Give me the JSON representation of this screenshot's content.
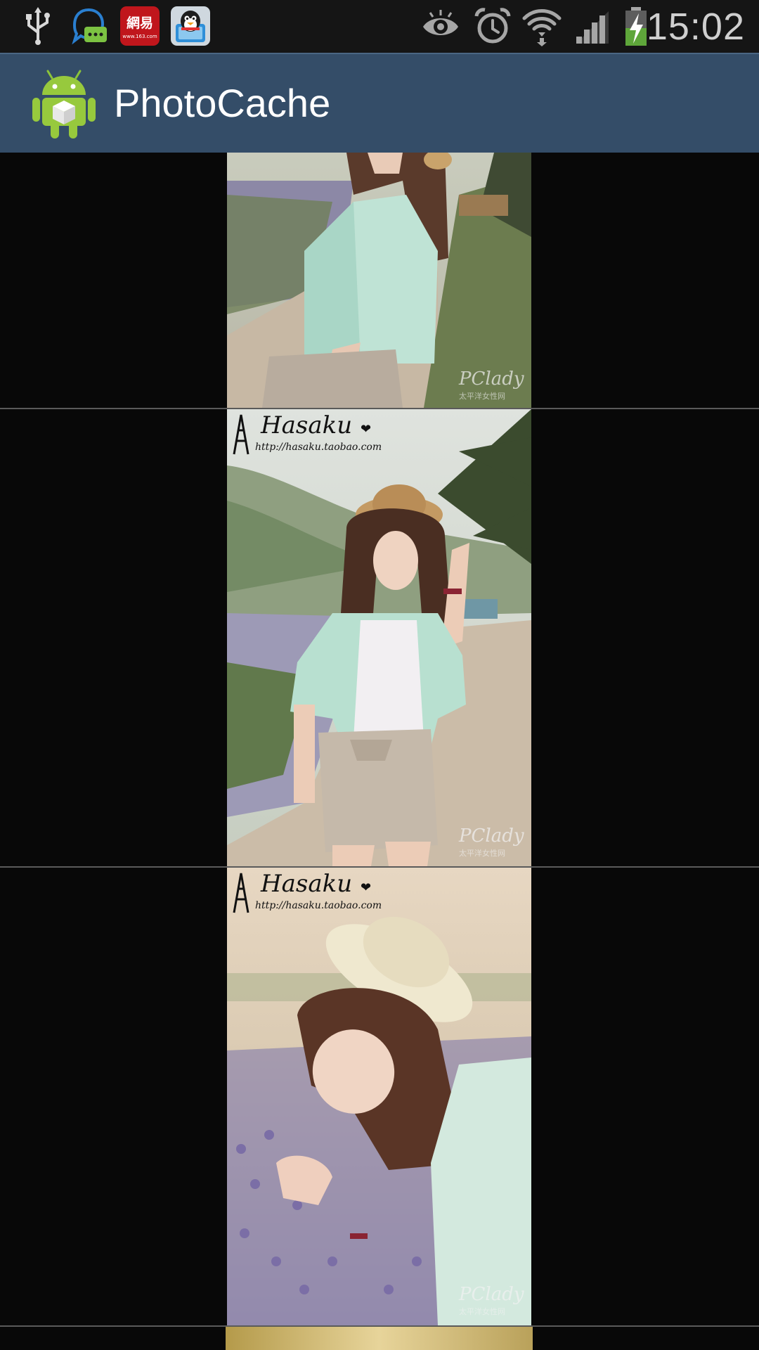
{
  "status_bar": {
    "time": "15:02",
    "notification_icons": [
      "usb-icon",
      "chat-bubble-icon",
      "netease-icon",
      "qq-penguin-icon"
    ],
    "system_icons": [
      "eye-icon",
      "alarm-clock-icon",
      "wifi-icon",
      "signal-bars-icon",
      "battery-charging-icon"
    ],
    "netease_label": "網易",
    "netease_sub": "www.163.com"
  },
  "action_bar": {
    "title": "PhotoCache",
    "icon": "android-app-icon",
    "color": "#344d68"
  },
  "photos": [
    {
      "watermark_pclady": "PClady",
      "watermark_sub": "太平洋女性网"
    },
    {
      "watermark_brand": "Hasaku",
      "watermark_url": "http://hasaku.taobao.com",
      "watermark_pclady": "PClady",
      "watermark_sub": "太平洋女性网"
    },
    {
      "watermark_brand": "Hasaku",
      "watermark_url": "http://hasaku.taobao.com",
      "watermark_pclady": "PClady",
      "watermark_sub": "太平洋女性网"
    },
    {}
  ]
}
